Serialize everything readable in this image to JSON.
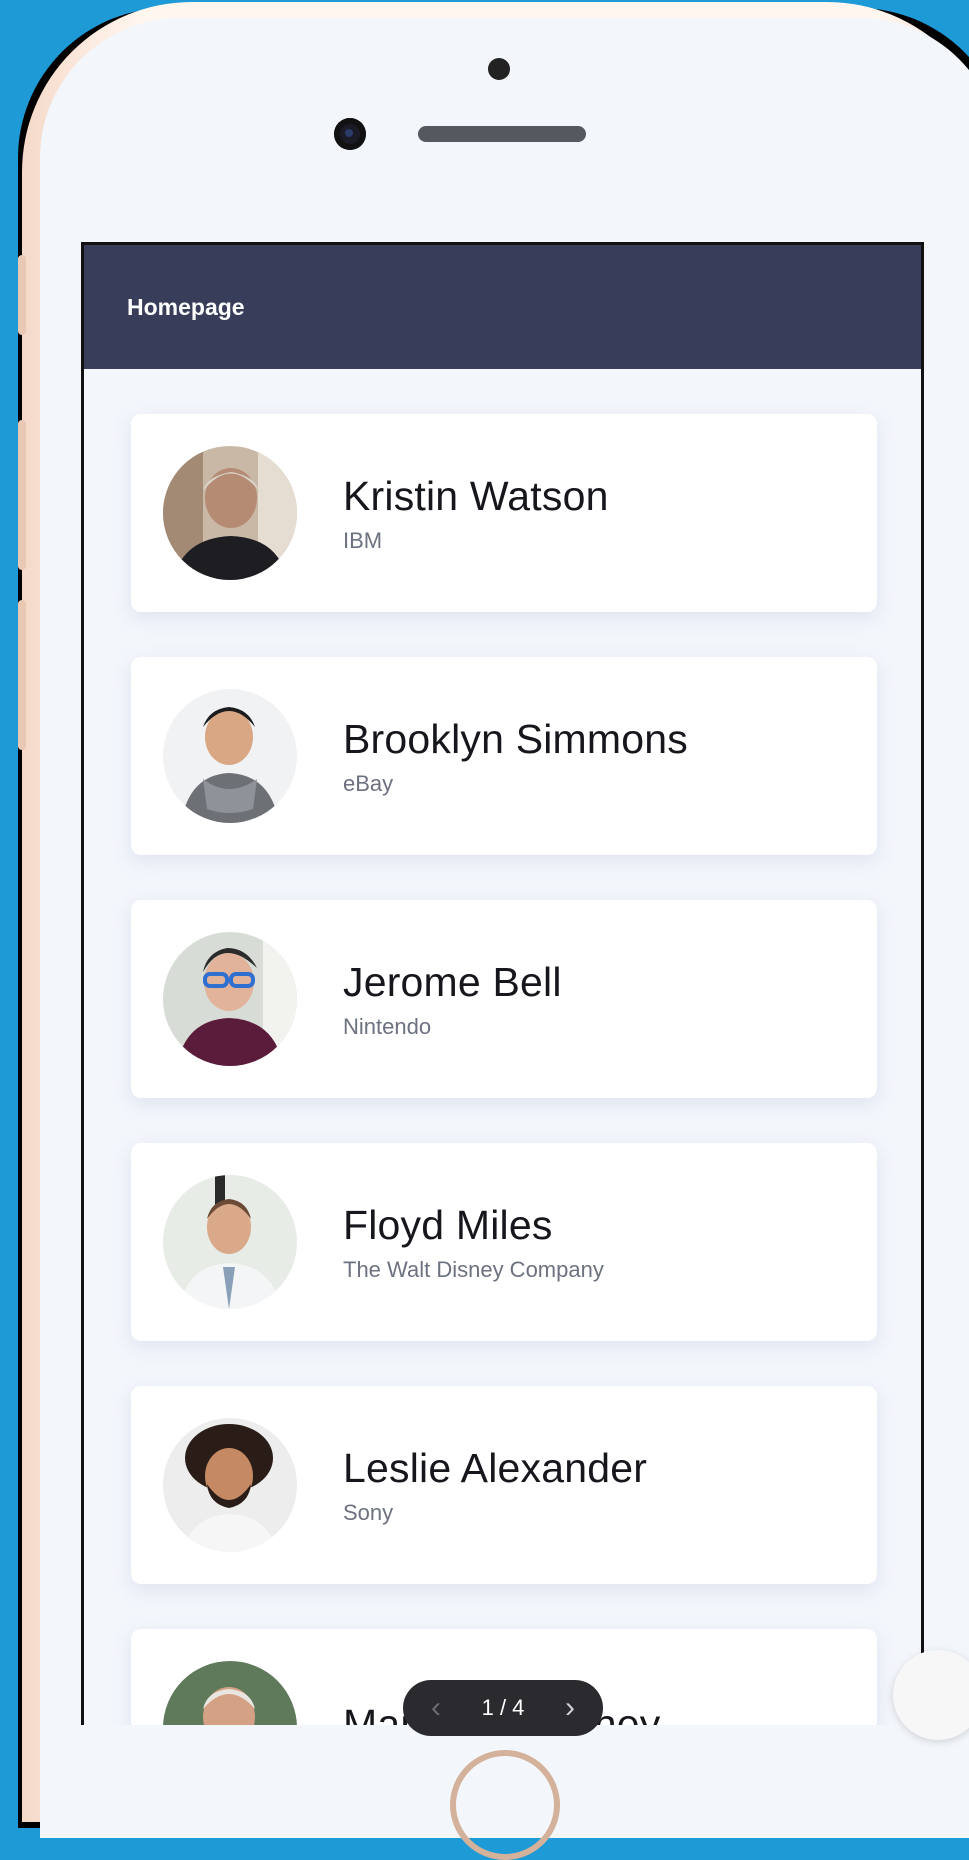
{
  "header": {
    "title": "Homepage"
  },
  "contacts": [
    {
      "name": "Kristin Watson",
      "company": "IBM"
    },
    {
      "name": "Brooklyn Simmons",
      "company": "eBay"
    },
    {
      "name": "Jerome Bell",
      "company": "Nintendo"
    },
    {
      "name": "Floyd Miles",
      "company": "The Walt Disney Company"
    },
    {
      "name": "Leslie Alexander",
      "company": "Sony"
    },
    {
      "name": "Marvin McKinney",
      "company": ""
    }
  ],
  "pager": {
    "label": "1 / 4",
    "prev_icon": "chevron-left-icon",
    "next_icon": "chevron-right-icon"
  },
  "colors": {
    "background": "#1e9ad6",
    "header": "#383d59",
    "card": "#ffffff",
    "screen": "#f3f6fb"
  }
}
